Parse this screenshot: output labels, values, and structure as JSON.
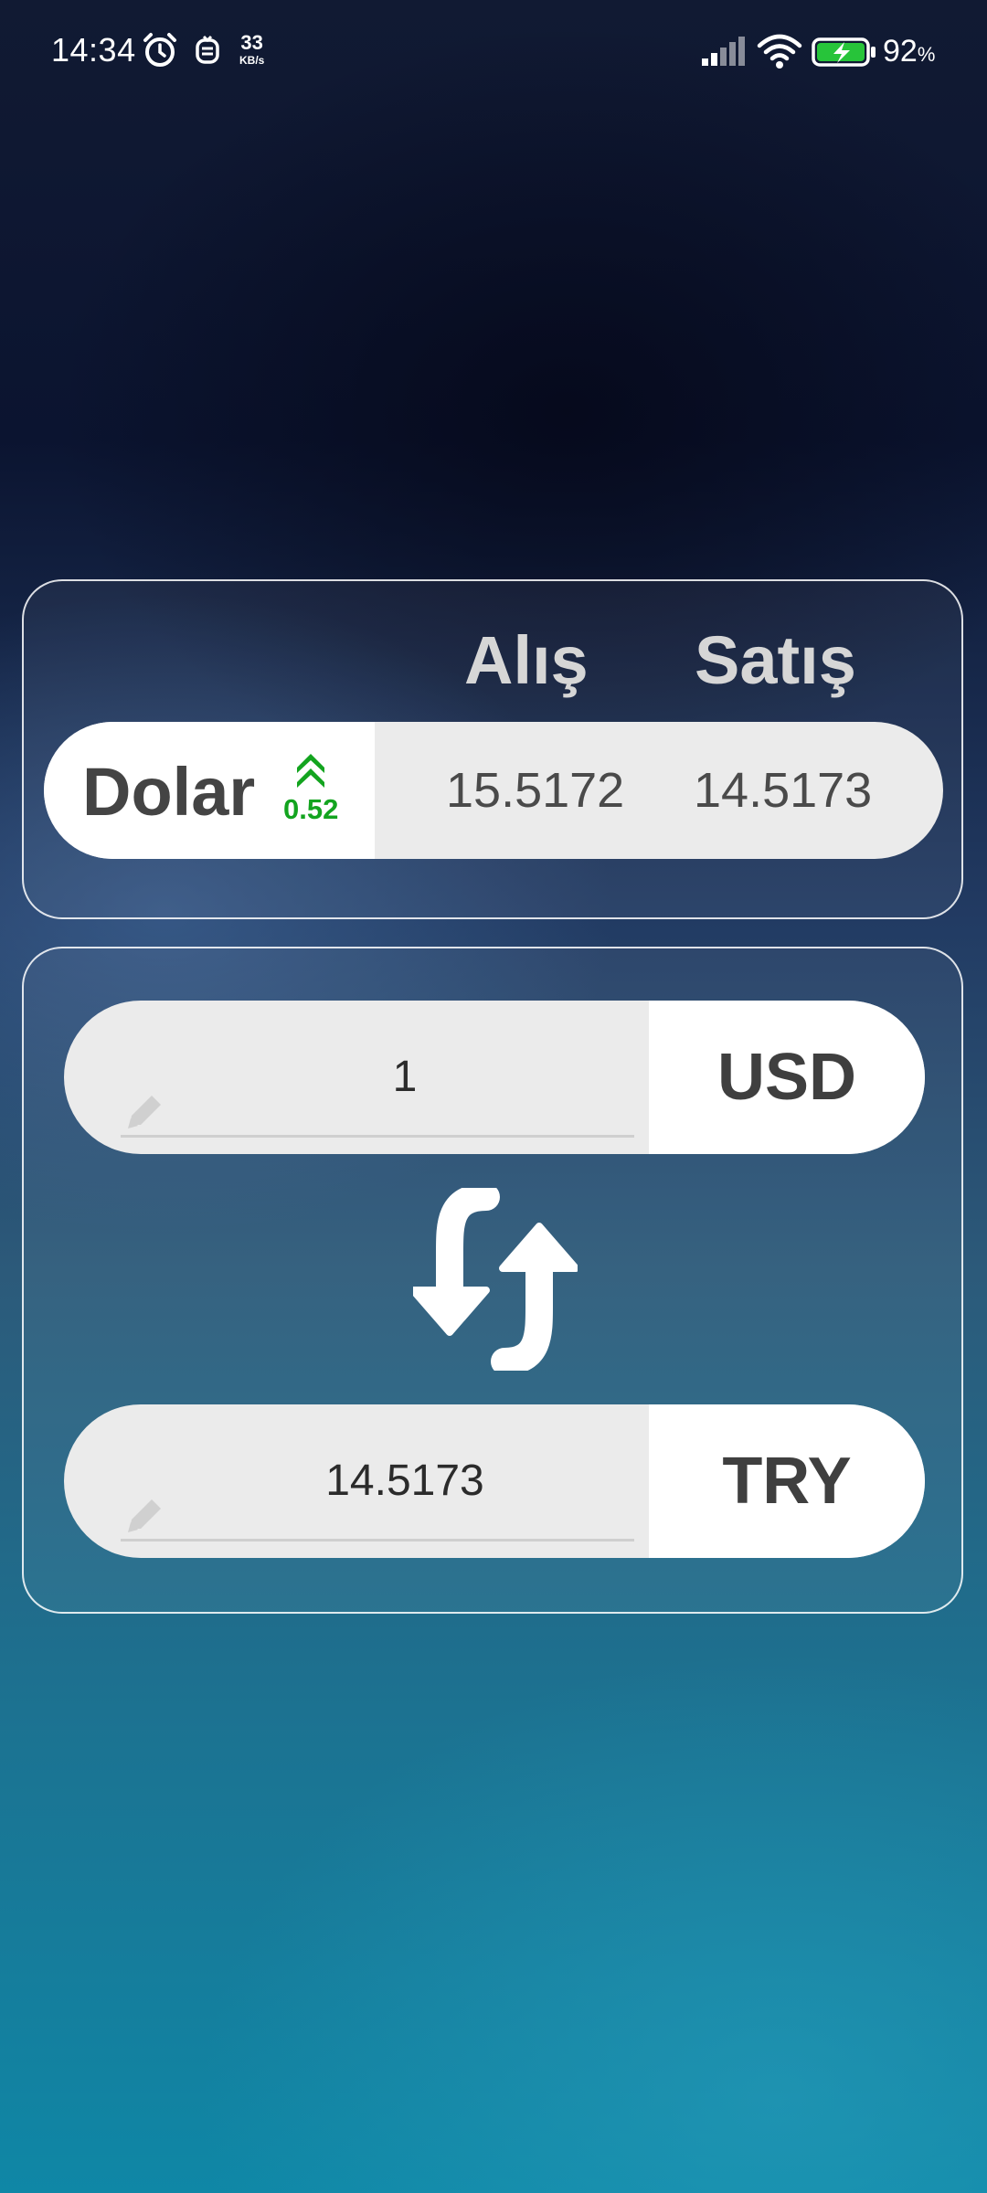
{
  "status_bar": {
    "time": "14:34",
    "net_speed_value": "33",
    "net_speed_unit": "KB/s",
    "battery_value": "92",
    "battery_unit": "%",
    "icons": [
      "alarm-icon",
      "face-icon",
      "signal-icon",
      "wifi-icon",
      "battery-charging-icon"
    ]
  },
  "rates": {
    "header_buy": "Alış",
    "header_sell": "Satış",
    "currency_name": "Dolar",
    "change": "0.52",
    "change_direction": "up",
    "buy": "15.5172",
    "sell": "14.5173"
  },
  "converter": {
    "from": {
      "amount": "1",
      "currency": "USD"
    },
    "to": {
      "amount": "14.5173",
      "currency": "TRY"
    },
    "swap_icon": "swap-arrows-icon"
  },
  "colors": {
    "change_up": "#13a41f",
    "card_border": "#ffffff",
    "row_bg": "#ebebeb"
  }
}
